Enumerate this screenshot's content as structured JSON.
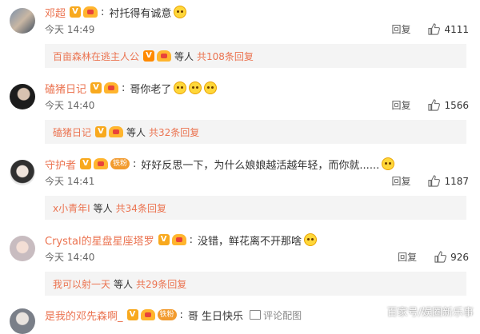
{
  "comments": [
    {
      "username": "邓超",
      "text": "衬托得有诚意",
      "time": "今天 14:49",
      "reply_label": "回复",
      "likes": "4111",
      "replies": {
        "name": "百亩森林在逃主人公",
        "mid": "等人",
        "total": "共108条回复"
      }
    },
    {
      "username": "磕猪日记",
      "text": "哥你老了",
      "time": "今天 14:40",
      "reply_label": "回复",
      "likes": "1566",
      "replies": {
        "name": "磕猪日记",
        "mid": "等人",
        "total": "共32条回复"
      }
    },
    {
      "username": "守护者",
      "fan_tag": "铁粉",
      "text": "好好反思一下，为什么娘娘越活越年轻，而你就......",
      "time": "今天 14:41",
      "reply_label": "回复",
      "likes": "1187",
      "replies": {
        "name": "x小青年I",
        "mid": "等人",
        "total": "共34条回复"
      }
    },
    {
      "username": "Crystal的星盘星座塔罗",
      "text": "没错，鲜花离不开那啥",
      "time": "今天 14:40",
      "reply_label": "回复",
      "likes": "926",
      "replies": {
        "name": "我可以射一天",
        "mid": "等人",
        "total": "共29条回复"
      }
    },
    {
      "username": "是我的邓先森啊_",
      "fan_tag": "铁粉",
      "text": "哥 生日快乐",
      "pic_link": "评论配图"
    }
  ],
  "watermark": "百家号/娱圈新乐事",
  "colors": {
    "username": "#eb7350",
    "subbox_bg": "#f4f4f4",
    "vip_badge": "#f8a91e"
  },
  "icons": {
    "like": "thumbs-up-icon",
    "emoji": "smile-emoji-icon",
    "vip": "v-badge-icon"
  }
}
